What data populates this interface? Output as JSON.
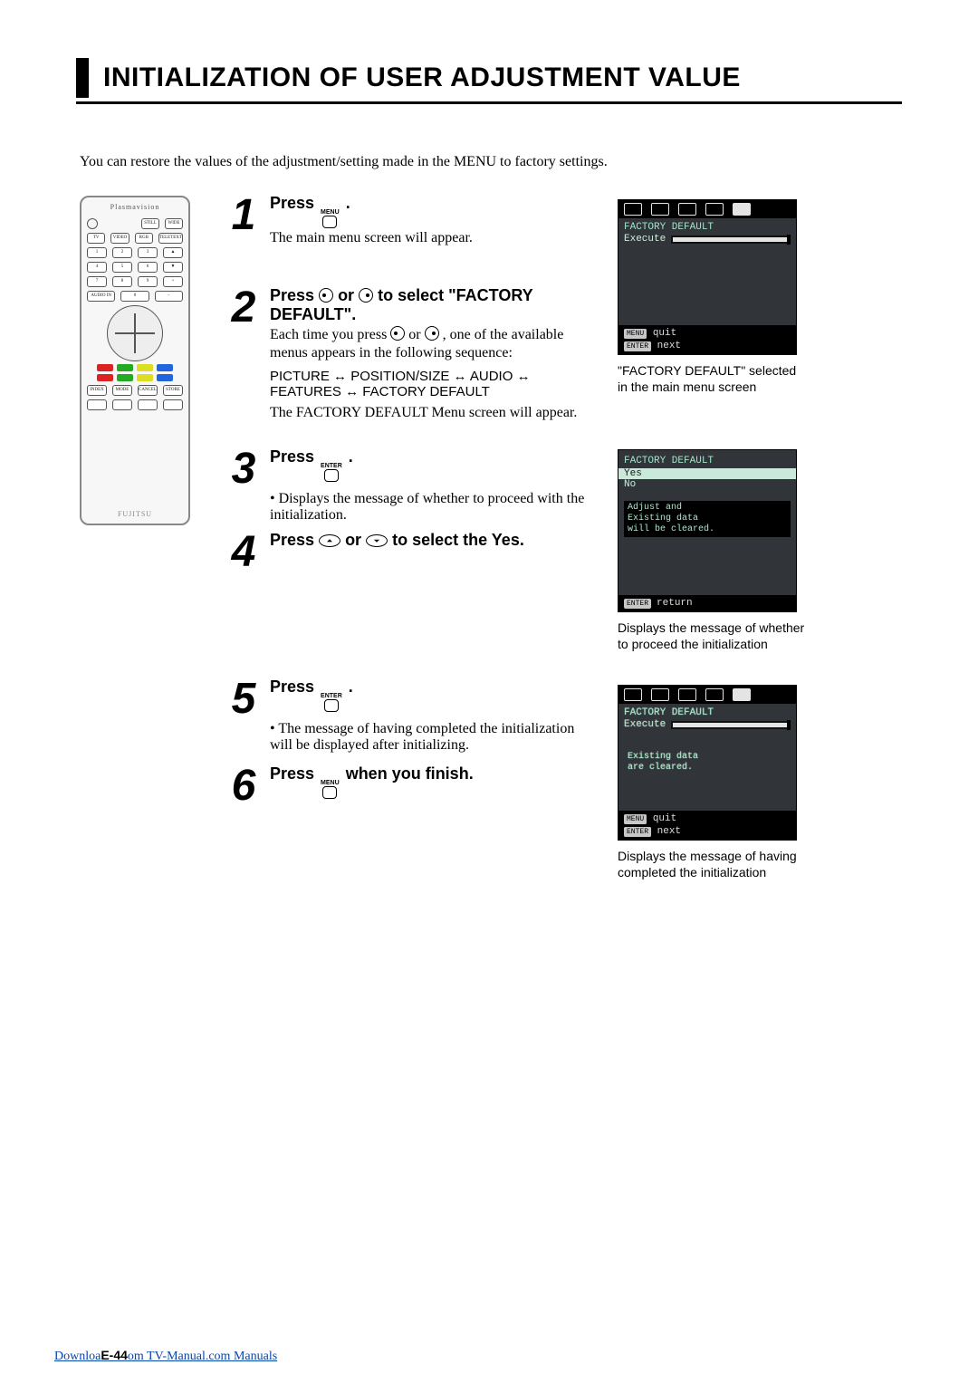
{
  "title": "INITIALIZATION OF USER ADJUSTMENT VALUE",
  "intro": "You can restore the values of the adjustment/setting made in the MENU to factory settings.",
  "remote": {
    "brand": "Plasmavision",
    "maker": "FUJITSU"
  },
  "steps": {
    "s1": {
      "num": "1",
      "head_pre": "Press ",
      "btn": "MENU",
      "head_post": ".",
      "desc": "The main menu screen will appear."
    },
    "s2": {
      "num": "2",
      "head_pre": "Press ",
      "head_mid": " or ",
      "head_post": " to select \"FACTORY DEFAULT\".",
      "desc": "menus appears in the following sequence:",
      "each_pre": "Each time you press ",
      "each_mid": " or ",
      "each_post": ", one of the available",
      "seq_a": "PICTURE",
      "seq_b": "POSITION/SIZE",
      "seq_c": "AUDIO",
      "seq_d": "FEATURES",
      "seq_e": "FACTORY DEFAULT",
      "desc2": "The FACTORY DEFAULT Menu screen will appear."
    },
    "s3": {
      "num": "3",
      "head_pre": "Press ",
      "btn": "ENTER",
      "head_post": ".",
      "bullet": "Displays the message of whether to proceed with the initialization."
    },
    "s4": {
      "num": "4",
      "head_pre": "Press ",
      "head_mid": " or ",
      "head_post": " to select the Yes."
    },
    "s5": {
      "num": "5",
      "head_pre": "Press ",
      "btn": "ENTER",
      "head_post": ".",
      "bullet": "The message of having completed the initialization will be displayed after initializing."
    },
    "s6": {
      "num": "6",
      "head_pre": "Press ",
      "btn": "MENU",
      "head_post": " when you finish."
    }
  },
  "osd1": {
    "title": "FACTORY DEFAULT",
    "row1": "Execute",
    "foot1_btn": "MENU",
    "foot1_lbl": "quit",
    "foot2_btn": "ENTER",
    "foot2_lbl": "next"
  },
  "cap1": "\"FACTORY DEFAULT\" selected in the main menu screen",
  "osd2": {
    "title": "FACTORY DEFAULT",
    "yes": "Yes",
    "no": "No",
    "msg1": "Adjust and",
    "msg2": "Existing data",
    "msg3": "will be cleared.",
    "foot_btn": "ENTER",
    "foot_lbl": "return"
  },
  "cap2": "Displays the message of whether to proceed the initialization",
  "osd3": {
    "title": "FACTORY DEFAULT",
    "row1": "Execute",
    "msg1": "Existing data",
    "msg2": "are cleared.",
    "foot1_btn": "MENU",
    "foot1_lbl": "quit",
    "foot2_btn": "ENTER",
    "foot2_lbl": "next"
  },
  "cap3": "Displays the message of having completed the initialization",
  "footer_pre": "Downloa",
  "footer_page": "E-44",
  "footer_post": "om TV-Manual.com Manuals"
}
